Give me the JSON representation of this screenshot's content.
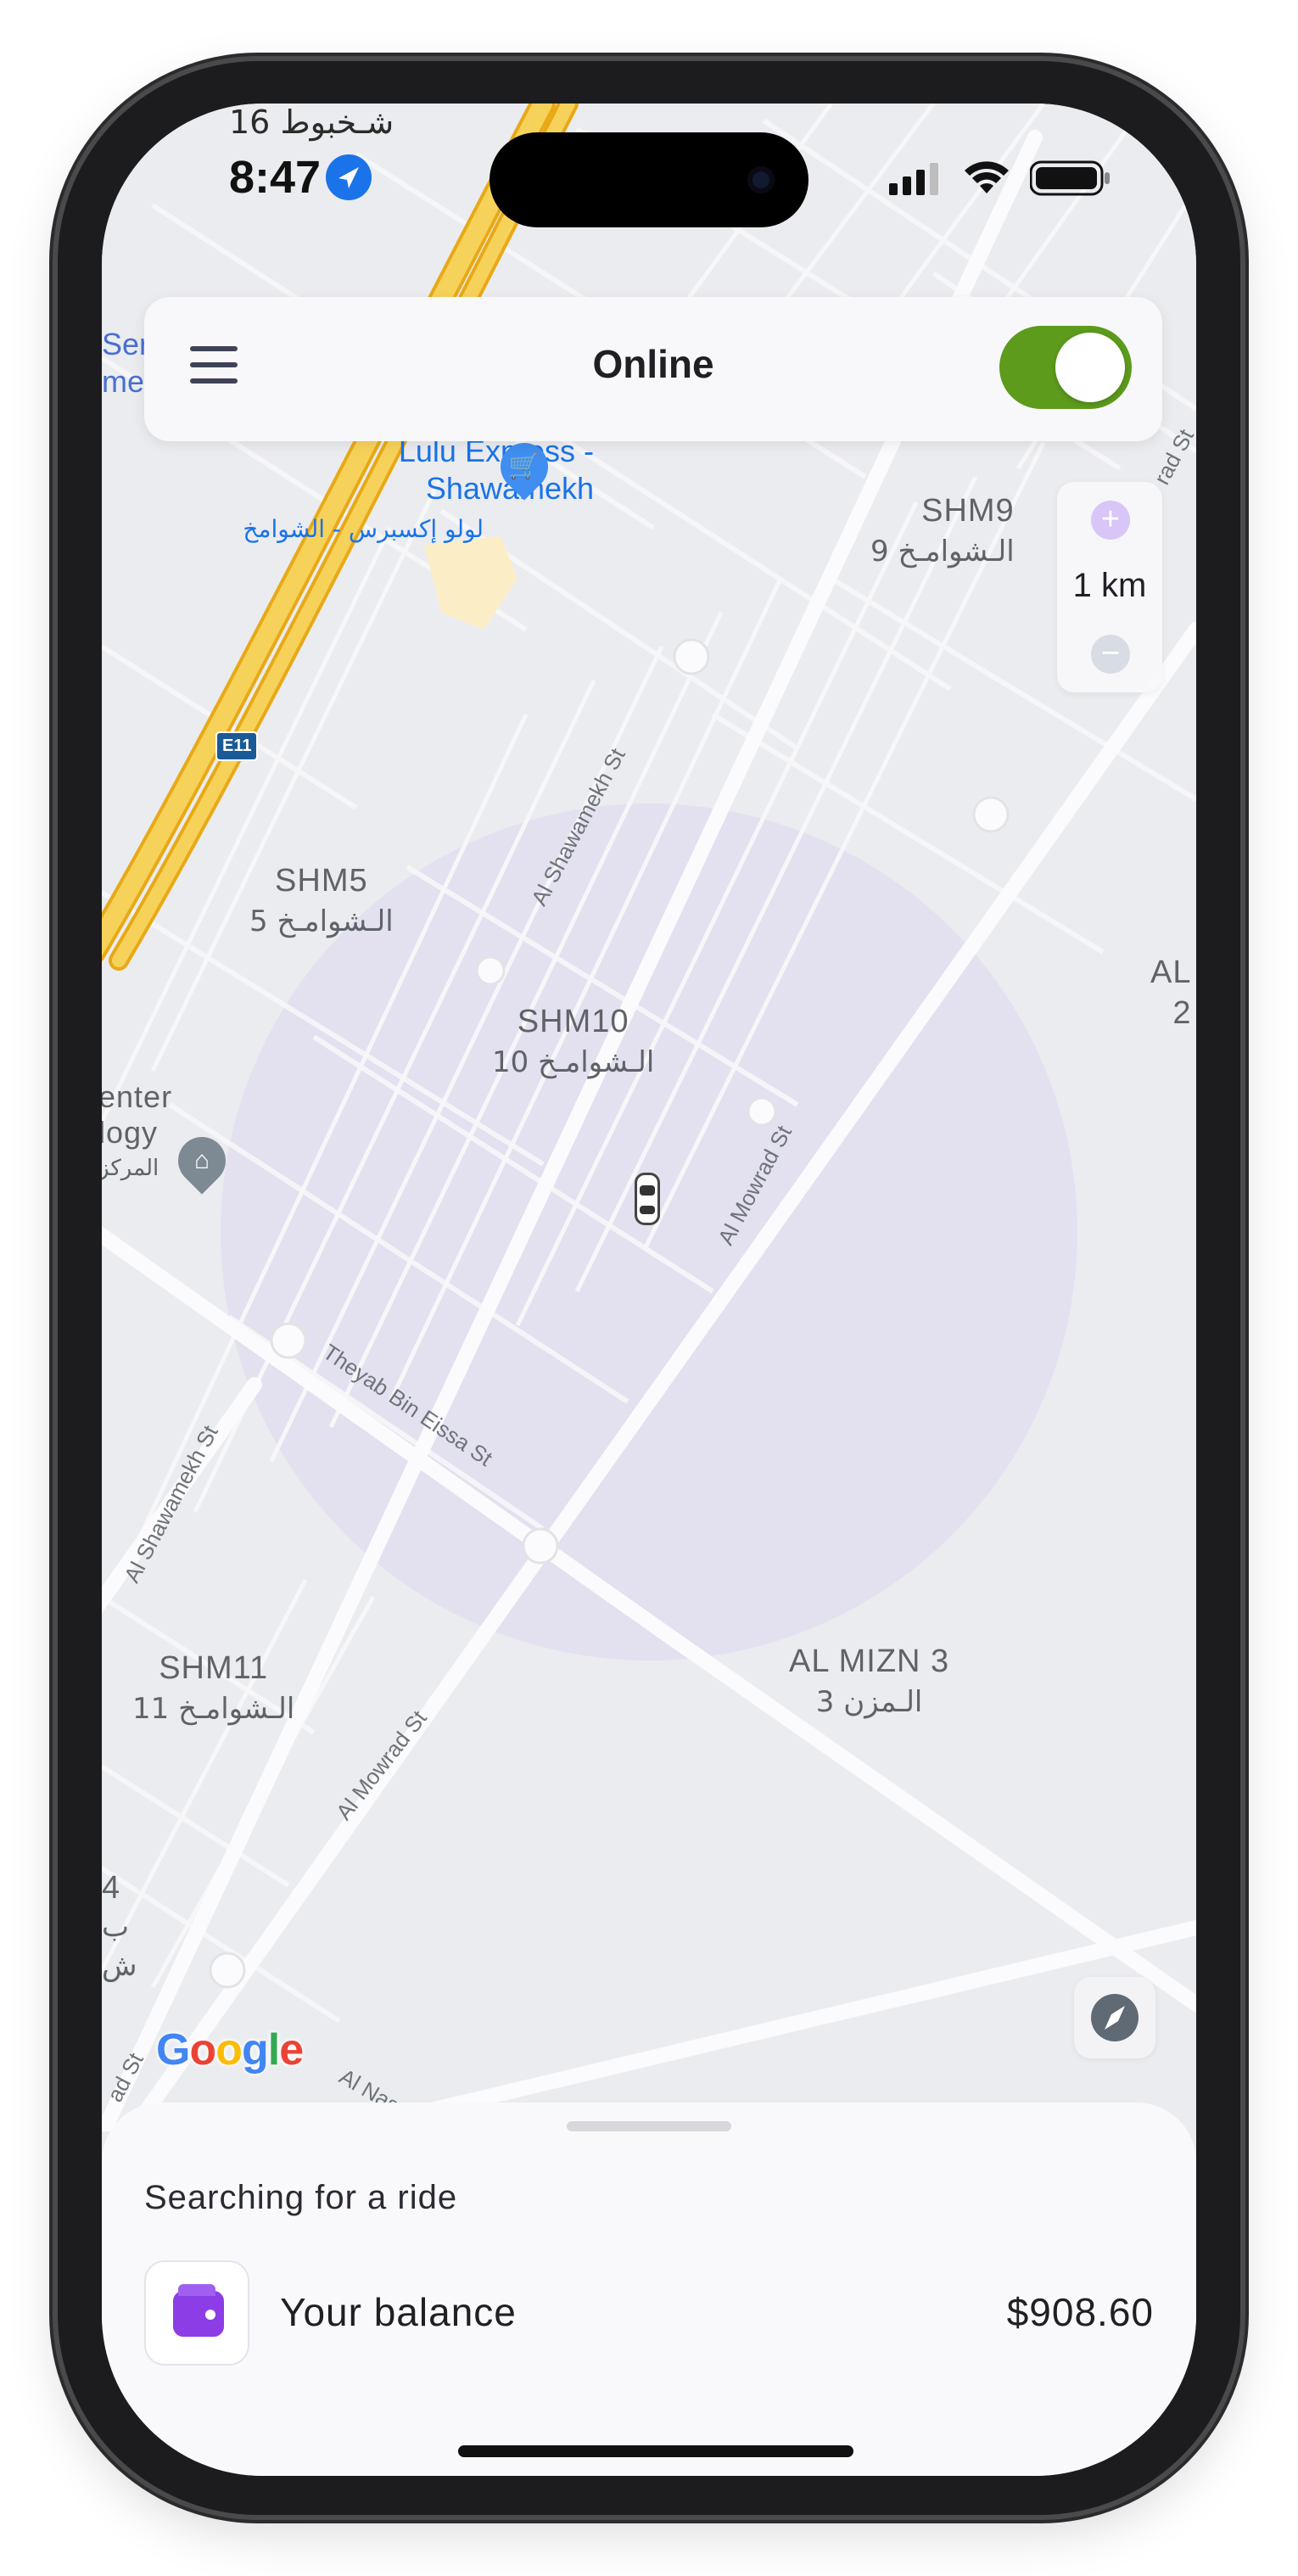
{
  "status_bar": {
    "top_text": "شـخبوط 16",
    "time": "8:47"
  },
  "header": {
    "title": "Online",
    "toggle_on": true,
    "toggle_color": "#5c9b1c"
  },
  "zoom": {
    "scale_label": "1 km",
    "zoom_in_symbol": "+",
    "zoom_out_symbol": "−"
  },
  "map": {
    "areas": [
      {
        "en": "SHM9",
        "ar": "الـشوامـخ 9"
      },
      {
        "en": "SHM5",
        "ar": "الـشوامـخ 5"
      },
      {
        "en": "SHM10",
        "ar": "الـشوامـخ 10"
      },
      {
        "en": "SHM11",
        "ar": "الـشوامـخ 11"
      },
      {
        "en": "AL MIZN 3",
        "ar": "الـمزن 3"
      }
    ],
    "edge_labels": {
      "left_top": "Ser",
      "left_top2": "me",
      "right_mid": "AL",
      "right_mid2": "2",
      "left_center1": "enter",
      "left_center2": "logy",
      "left_center3": "المركز",
      "left_bottom1": "4",
      "left_bottom2": "ب",
      "left_bottom3": "ش"
    },
    "poi": {
      "name_line1": "Lulu Express -",
      "name_line2": "Shawamekh",
      "name_ar": "لولو إكسبرس - الشوامخ"
    },
    "highway": "E11",
    "streets": [
      "Al Shawamekh St",
      "Al Mowrad St",
      "Theyab Bin Eissa St",
      "Al Shawamekh St",
      "Al Mowrad St",
      "rad St",
      "Al Nas",
      "ad St"
    ],
    "google_logo": [
      "G",
      "o",
      "o",
      "g",
      "l",
      "e"
    ],
    "google_colors": [
      "#4285F4",
      "#EA4335",
      "#FBBC05",
      "#4285F4",
      "#34A853",
      "#EA4335"
    ]
  },
  "sheet": {
    "status": "Searching for a ride",
    "balance_label": "Your balance",
    "balance_value": "$908.60"
  },
  "colors": {
    "accent_purple": "#8c3de6",
    "map_bg": "#ebecef",
    "road_major": "#fbfbfd",
    "highway": "#f4c542",
    "search_radius": "#d9d5ef"
  }
}
